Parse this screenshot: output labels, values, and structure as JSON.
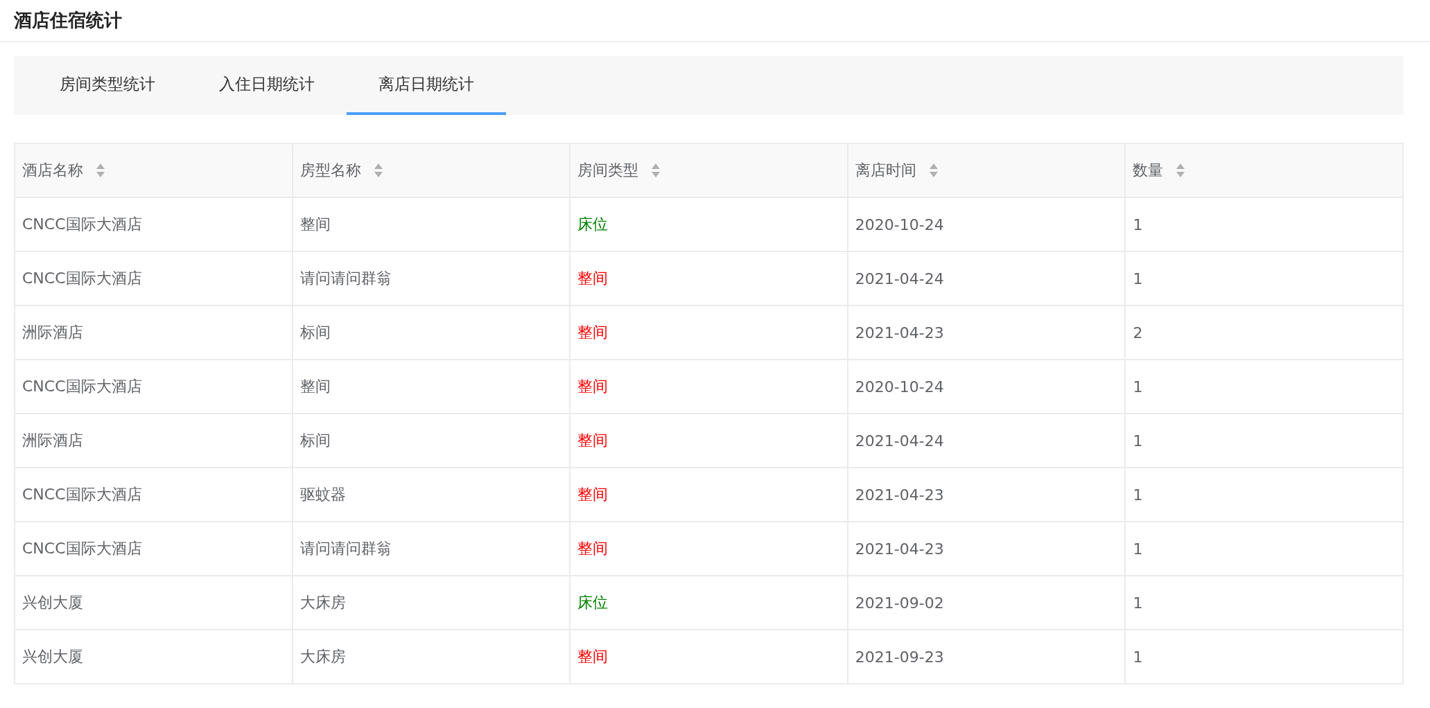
{
  "page": {
    "title": "酒店住宿统计"
  },
  "tabs": [
    {
      "label": "房间类型统计",
      "selected": false
    },
    {
      "label": "入住日期统计",
      "selected": false
    },
    {
      "label": "离店日期统计",
      "selected": true
    }
  ],
  "table": {
    "columns": [
      "酒店名称",
      "房型名称",
      "房间类型",
      "离店时间",
      "数量"
    ],
    "rows": [
      {
        "hotel": "CNCC国际大酒店",
        "room_name": "整间",
        "room_type": {
          "text": "床位",
          "color": "#008000"
        },
        "checkout": "2020-10-24",
        "count": "1"
      },
      {
        "hotel": "CNCC国际大酒店",
        "room_name": "请问请问群翁",
        "room_type": {
          "text": "整间",
          "color": "#ff0000"
        },
        "checkout": "2021-04-24",
        "count": "1"
      },
      {
        "hotel": "洲际酒店",
        "room_name": "标间",
        "room_type": {
          "text": "整间",
          "color": "#ff0000"
        },
        "checkout": "2021-04-23",
        "count": "2"
      },
      {
        "hotel": "CNCC国际大酒店",
        "room_name": "整间",
        "room_type": {
          "text": "整间",
          "color": "#ff0000"
        },
        "checkout": "2020-10-24",
        "count": "1"
      },
      {
        "hotel": "洲际酒店",
        "room_name": "标间",
        "room_type": {
          "text": "整间",
          "color": "#ff0000"
        },
        "checkout": "2021-04-24",
        "count": "1"
      },
      {
        "hotel": "CNCC国际大酒店",
        "room_name": "驱蚊器",
        "room_type": {
          "text": "整间",
          "color": "#ff0000"
        },
        "checkout": "2021-04-23",
        "count": "1"
      },
      {
        "hotel": "CNCC国际大酒店",
        "room_name": "请问请问群翁",
        "room_type": {
          "text": "整间",
          "color": "#ff0000"
        },
        "checkout": "2021-04-23",
        "count": "1"
      },
      {
        "hotel": "兴创大厦",
        "room_name": "大床房",
        "room_type": {
          "text": "床位",
          "color": "#008000"
        },
        "checkout": "2021-09-02",
        "count": "1"
      },
      {
        "hotel": "兴创大厦",
        "room_name": "大床房",
        "room_type": {
          "text": "整间",
          "color": "#ff0000"
        },
        "checkout": "2021-09-23",
        "count": "1"
      }
    ]
  }
}
